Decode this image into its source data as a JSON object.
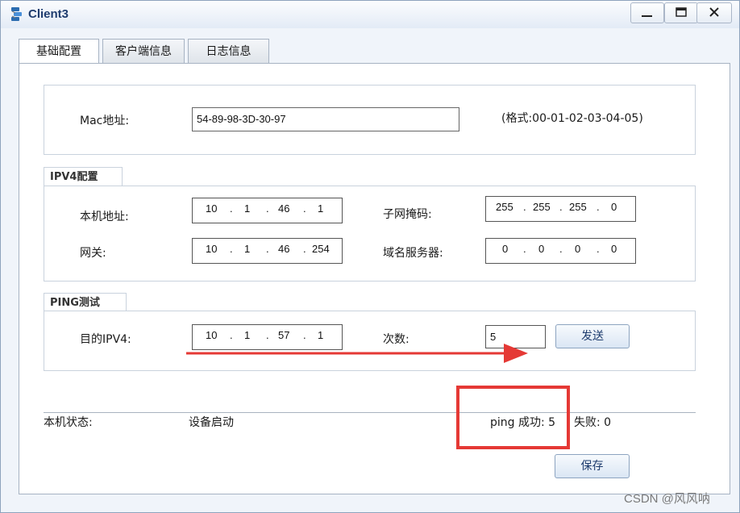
{
  "window": {
    "title": "Client3"
  },
  "tabs": [
    {
      "label": "基础配置"
    },
    {
      "label": "客户端信息"
    },
    {
      "label": "日志信息"
    }
  ],
  "mac": {
    "label": "Mac地址:",
    "value": "54-89-98-3D-30-97",
    "hint": "(格式:00-01-02-03-04-05)"
  },
  "ipv4": {
    "legend": "IPV4配置",
    "local_label": "本机地址:",
    "local": [
      "10",
      "1",
      "46",
      "1"
    ],
    "mask_label": "子网掩码:",
    "mask": [
      "255",
      "255",
      "255",
      "0"
    ],
    "gateway_label": "网关:",
    "gateway": [
      "10",
      "1",
      "46",
      "254"
    ],
    "dns_label": "域名服务器:",
    "dns": [
      "0",
      "0",
      "0",
      "0"
    ]
  },
  "ping": {
    "legend": "PING测试",
    "dest_label": "目的IPV4:",
    "dest": [
      "10",
      "1",
      "57",
      "1"
    ],
    "count_label": "次数:",
    "count": "5",
    "send_label": "发送"
  },
  "status": {
    "label": "本机状态:",
    "value": "设备启动",
    "ping_success": "ping 成功: 5",
    "fail": "失败: 0"
  },
  "save_label": "保存",
  "watermark": "CSDN @风风呐",
  "annotation_color": "#e53935"
}
